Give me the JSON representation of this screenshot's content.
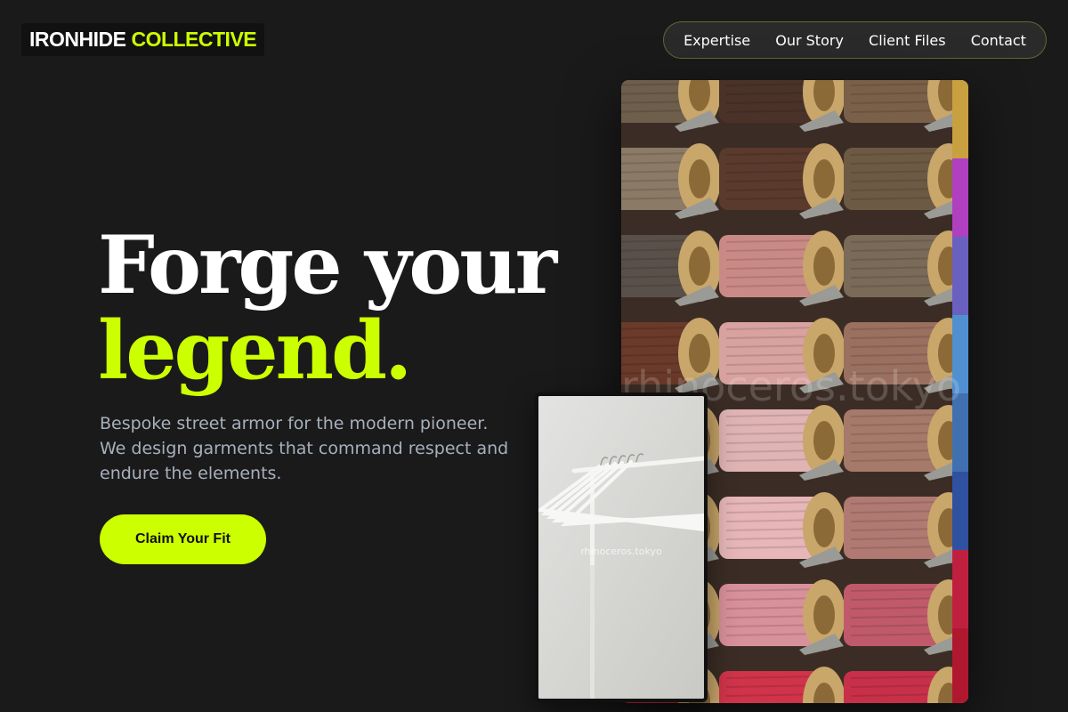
{
  "brand": {
    "name_part1": "IRONHIDE",
    "name_part2": "COLLECTIVE",
    "accent_color": "#ccff00"
  },
  "nav": {
    "items": [
      {
        "label": "Expertise"
      },
      {
        "label": "Our Story"
      },
      {
        "label": "Client Files"
      },
      {
        "label": "Contact"
      }
    ]
  },
  "hero": {
    "headline_line1": "Forge your",
    "headline_line2": "legend.",
    "tagline": "Bespoke street armor for the modern pioneer. We design garments that command respect and endure the elements.",
    "cta_label": "Claim Your Fit"
  },
  "images": {
    "main": {
      "subject": "spools of thread",
      "watermark": "rhinoceros.tokyo"
    },
    "secondary": {
      "subject": "white hangers on clothing rack",
      "watermark": "rhinoceros.tokyo"
    }
  },
  "colors": {
    "background": "#1a1a1a",
    "accent": "#ccff00",
    "text_muted": "#a7b0bd"
  }
}
